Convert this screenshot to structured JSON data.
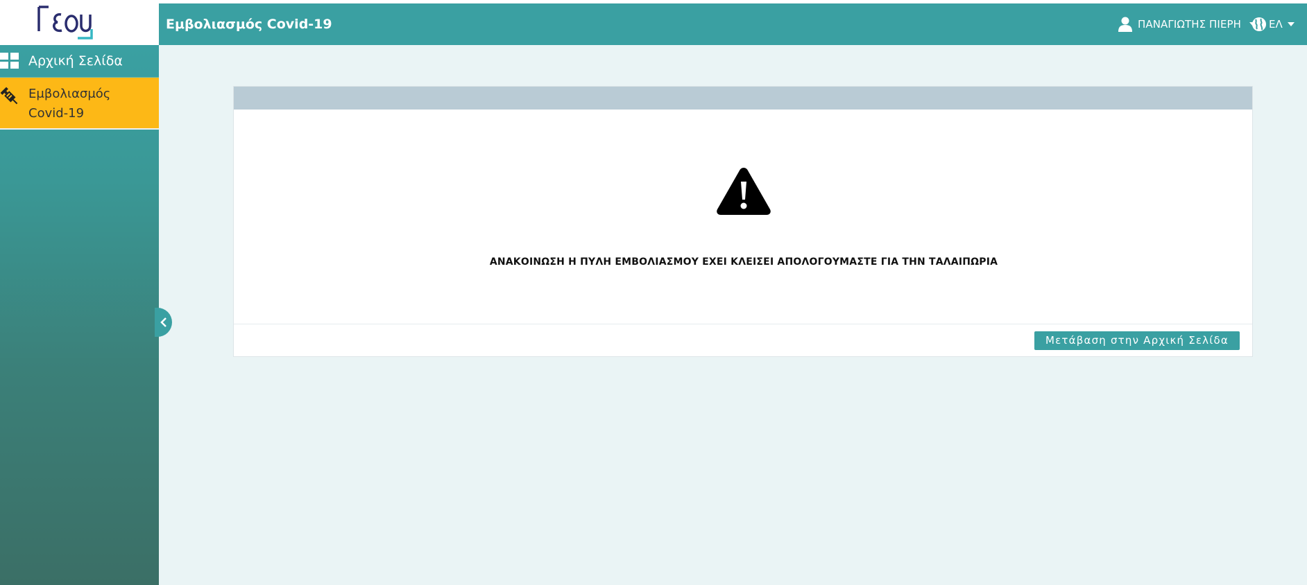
{
  "header": {
    "logo_text": "ΓΕΣΥ",
    "title": "Εμβολιασμός Covid-19",
    "user_name": "ΠΑΝΑΓΙΩΤΗΣ ΠΙΕΡΗ",
    "language": "ΕΛ"
  },
  "sidebar": {
    "items": [
      {
        "label": "Αρχική Σελίδα",
        "icon": "dashboard-grid-icon"
      },
      {
        "label_line1": "Εμβολιασμός",
        "label_line2": "Covid-19",
        "icon": "syringe-icon",
        "active": true
      }
    ]
  },
  "main": {
    "announcement": "ΑΝΑΚΟΙΝΩΣΗ Η ΠΥΛΗ ΕΜΒΟΛΙΑΣΜΟΥ ΕΧΕΙ ΚΛΕΙΣΕΙ ΑΠΟΛΟΓΟΥΜΑΣΤΕ ΓΙΑ ΤΗΝ ΤΑΛΑΙΠΩΡΙΑ",
    "home_button": "Μετάβαση στην Αρχική Σελίδα"
  },
  "colors": {
    "primary": "#3aa0a2",
    "active_item": "#fdb816",
    "logo_navy": "#2a2d6e",
    "logo_teal": "#36b7c4"
  }
}
